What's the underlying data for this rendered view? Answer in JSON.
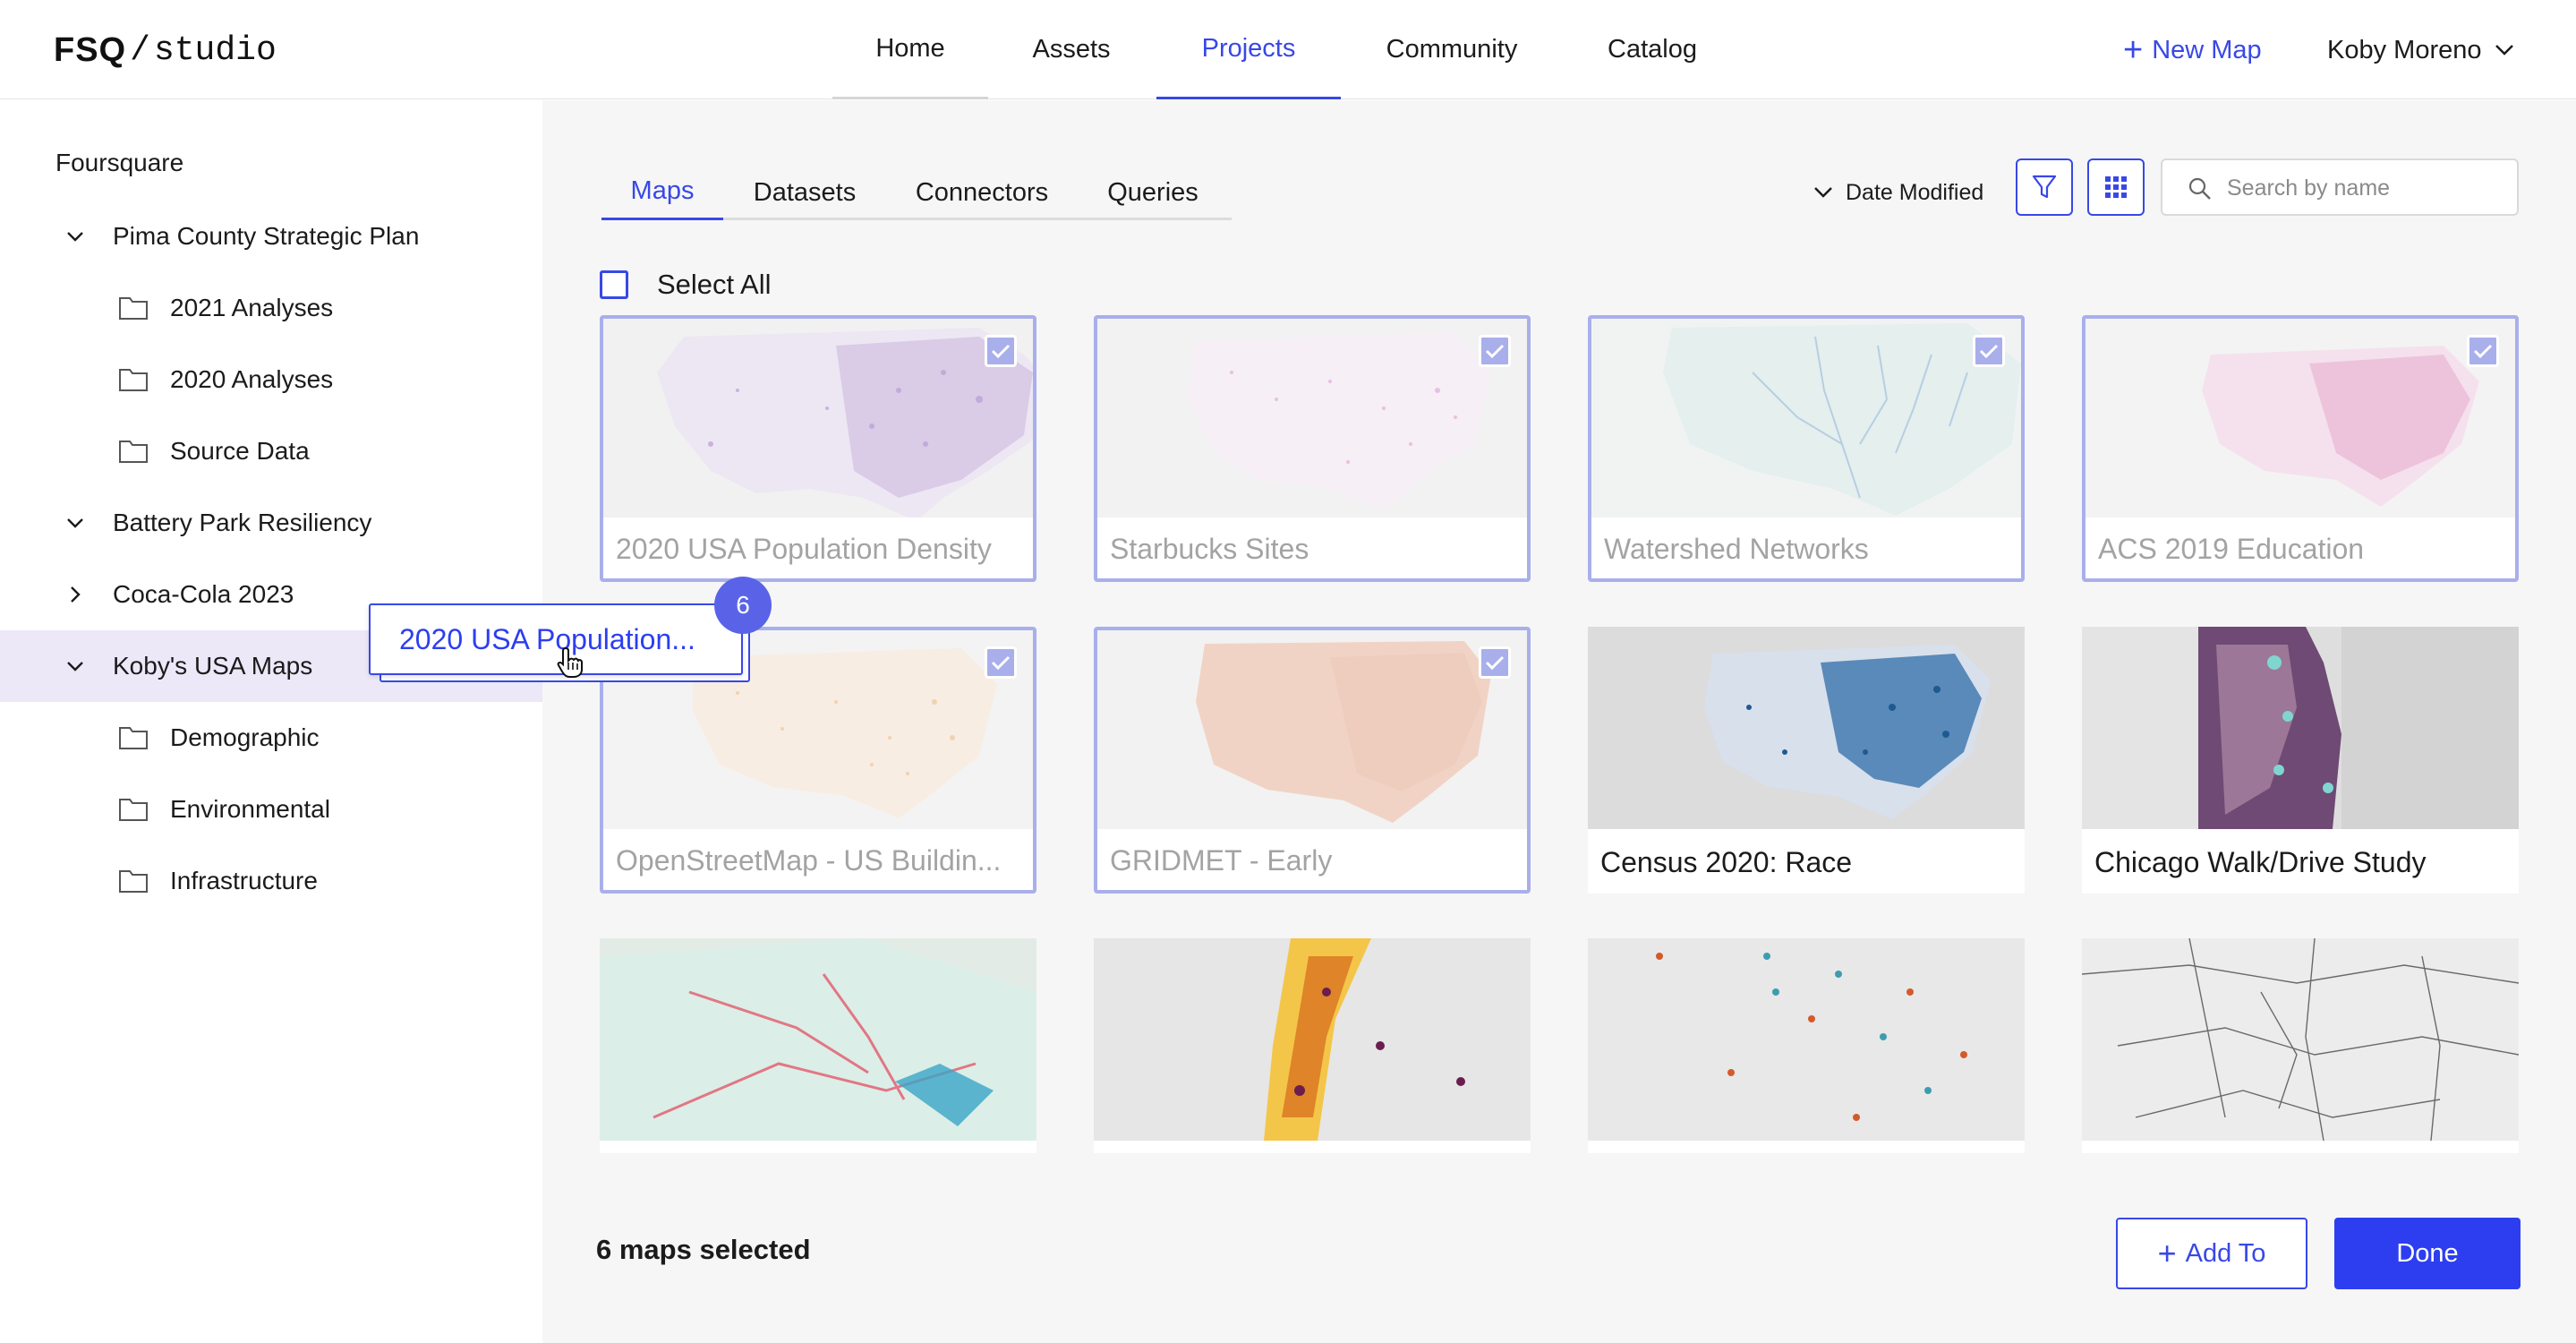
{
  "app": {
    "logo_brand": "FSQ",
    "logo_slash": "/",
    "logo_product": "studio"
  },
  "nav": {
    "items": [
      "Home",
      "Assets",
      "Projects",
      "Community",
      "Catalog"
    ],
    "active": "Projects",
    "new_map_label": "New Map",
    "user_name": "Koby Moreno"
  },
  "sidebar": {
    "org": "Foursquare",
    "tree": [
      {
        "label": "Pima County Strategic Plan",
        "type": "project",
        "expanded": true
      },
      {
        "label": "2021 Analyses",
        "type": "folder"
      },
      {
        "label": "2020 Analyses",
        "type": "folder"
      },
      {
        "label": "Source Data",
        "type": "folder"
      },
      {
        "label": "Battery Park Resiliency",
        "type": "project",
        "expanded": true
      },
      {
        "label": "Coca-Cola 2023",
        "type": "project",
        "expanded": false
      },
      {
        "label": "Koby's USA Maps",
        "type": "project",
        "expanded": true,
        "selected": true
      },
      {
        "label": "Demographic",
        "type": "folder"
      },
      {
        "label": "Environmental",
        "type": "folder"
      },
      {
        "label": "Infrastructure",
        "type": "folder"
      }
    ]
  },
  "toolbar": {
    "tabs": [
      "Maps",
      "Datasets",
      "Connectors",
      "Queries"
    ],
    "active_tab": "Maps",
    "sort_label": "Date Modified",
    "search_placeholder": "Search by name",
    "select_all_label": "Select All"
  },
  "maps": [
    {
      "title": "2020 USA Population Density",
      "selected": true,
      "thumb": "usa-purple-dots"
    },
    {
      "title": "Starbucks Sites",
      "selected": true,
      "thumb": "usa-pink-dots"
    },
    {
      "title": "Watershed Networks",
      "selected": true,
      "thumb": "usa-blue-rivers"
    },
    {
      "title": "ACS 2019 Education",
      "selected": true,
      "thumb": "usa-magenta"
    },
    {
      "title": "OpenStreetMap - US Buildin...",
      "selected": true,
      "thumb": "usa-orange-dots"
    },
    {
      "title": "GRIDMET - Early",
      "selected": true,
      "thumb": "usa-salmon-fill"
    },
    {
      "title": "Census 2020: Race",
      "selected": false,
      "thumb": "usa-blue-race"
    },
    {
      "title": "Chicago Walk/Drive Study",
      "selected": false,
      "thumb": "chicago-purple"
    },
    {
      "title": "",
      "selected": false,
      "thumb": "northeast-density"
    },
    {
      "title": "",
      "selected": false,
      "thumb": "nyc-hexbins"
    },
    {
      "title": "",
      "selected": false,
      "thumb": "scatter-clusters"
    },
    {
      "title": "",
      "selected": false,
      "thumb": "asia-roads"
    }
  ],
  "drag": {
    "label": "2020 USA Population...",
    "count": "6"
  },
  "footer": {
    "selected_count": "6 maps selected",
    "add_to_label": "Add To",
    "done_label": "Done"
  },
  "colors": {
    "accent": "#3848e6",
    "done_button": "#2c3ef0",
    "selected_border": "#a9afeb",
    "sidebar_selected_bg": "#ece8f8",
    "main_bg": "#f6f6f6"
  }
}
